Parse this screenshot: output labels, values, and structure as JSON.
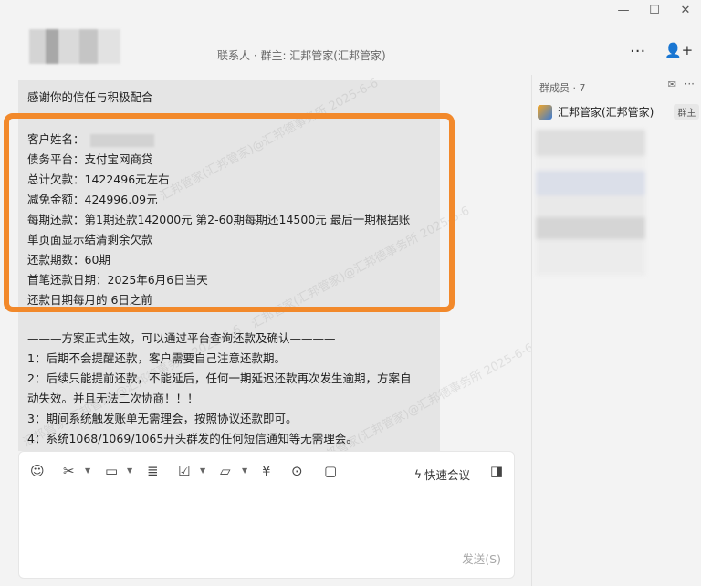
{
  "window": {
    "minimize": "—",
    "maximize": "☐",
    "close": "✕"
  },
  "header": {
    "title": "联系人 · 群主: 汇邦管家(汇邦管家)",
    "more_icon": "···",
    "add_member_icon": "👤+"
  },
  "members": {
    "title": "群成员 · 7",
    "mail_icon": "✉",
    "more_icon": "···",
    "first": {
      "name": "汇邦管家(汇邦管家)",
      "badge": "群主"
    }
  },
  "chat": {
    "intro": "感谢你的信任与积极配合",
    "lines": [
      "客户姓名：",
      "债务平台：支付宝网商贷",
      "总计欠款：1422496元左右",
      "减免金额：424996.09元",
      "每期还款：第1期还款142000元  第2-60期每期还14500元  最后一期根据账",
      "单页面显示结清剩余欠款",
      "还款期数：60期",
      "首笔还款日期：2025年6月6日当天",
      "还款日期每月的 6日之前"
    ],
    "notice_title": "———方案正式生效，可以通过平台查询还款及确认————",
    "notices": [
      "1：后期不会提醒还款，客户需要自己注意还款期。",
      "2：后续只能提前还款，不能延后，任何一期延迟还款再次发生逾期，方案自",
      "动失效。并且无法二次协商！！！",
      "3：期间系统触发账单无需理会，按照协议还款即可。",
      "4：系统1068/1069/1065开头群发的任何短信通知等无需理会。"
    ],
    "watermark": "汇邦管家(汇邦管家)@汇邦德事务所 2025-6-6"
  },
  "input": {
    "quick_meeting": "快速会议",
    "send": "发送(S)"
  }
}
